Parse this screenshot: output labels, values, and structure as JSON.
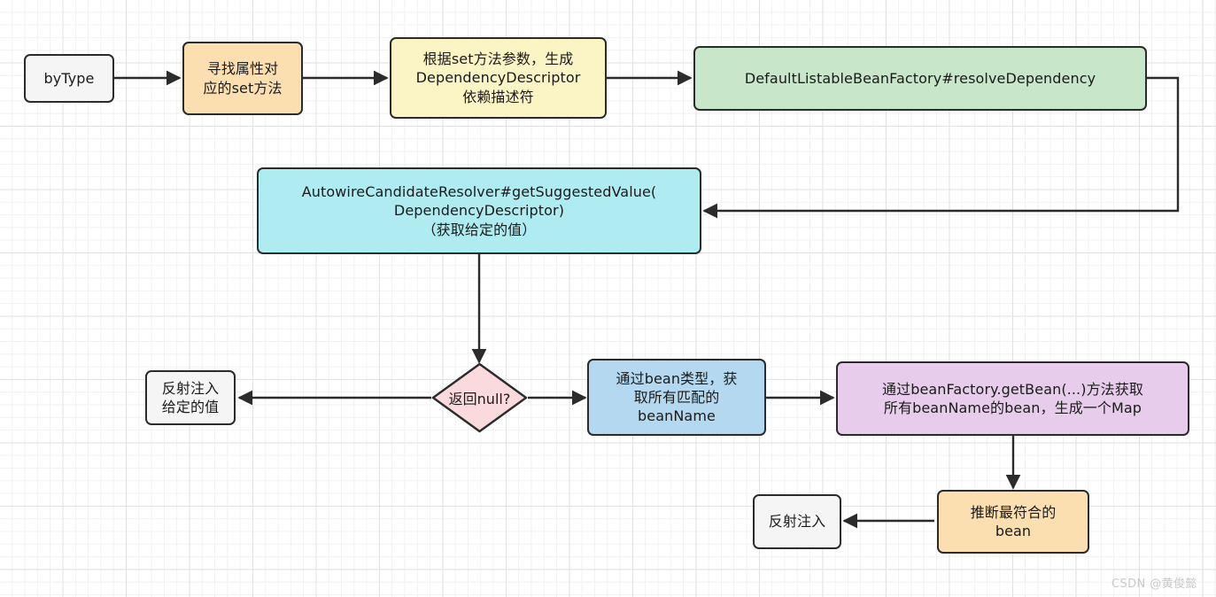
{
  "diagram": {
    "title": "byType Spring dependency injection flow",
    "watermark": "CSDN @黄俊懿",
    "colors": {
      "plain": "#f5f5f5",
      "orange": "#fcdfb1",
      "yellow": "#fbf4c4",
      "green": "#c8e6c9",
      "cyan": "#aeecf2",
      "blue": "#b4d8f0",
      "purple": "#e7cdeb",
      "pink": "#fadadd",
      "stroke": "#2b2b2b",
      "grid_minor": "#f2f2f2",
      "grid_major": "#e2e2e2"
    },
    "nodes": {
      "by_type": "byType",
      "find_setter": "寻找属性对\n应的set方法",
      "create_descriptor": "根据set方法参数，生成\nDependencyDescriptor\n依赖描述符",
      "resolve_dependency": "DefaultListableBeanFactory#resolveDependency",
      "suggested_value": "AutowireCandidateResolver#getSuggestedValue(\nDependencyDescriptor)\n（获取给定的值）",
      "return_null_decision": "返回null?",
      "inject_given_value": "反射注入\n给定的值",
      "get_bean_names": "通过bean类型，获\n取所有匹配的\nbeanName",
      "get_beans_map": "通过beanFactory.getBean(...)方法获取\n所有beanName的bean，生成一个Map",
      "infer_best_bean": "推断最符合的\nbean",
      "reflect_inject": "反射注入"
    }
  }
}
